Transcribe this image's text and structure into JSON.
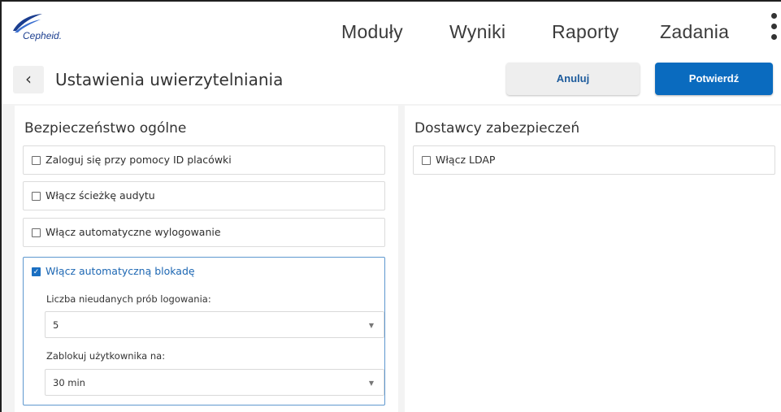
{
  "header": {
    "logo_text": "Cepheid.",
    "nav": [
      "Moduły",
      "Wyniki",
      "Raporty",
      "Zadania"
    ]
  },
  "subheader": {
    "back_icon": "‹",
    "title": "Ustawienia uwierzytelniania",
    "cancel_label": "Anuluj",
    "confirm_label": "Potwierdź"
  },
  "left": {
    "title": "Bezpieczeństwo ogólne",
    "options": [
      {
        "label": "Zaloguj się przy pomocy ID placówki",
        "checked": false
      },
      {
        "label": "Włącz ścieżkę audytu",
        "checked": false
      },
      {
        "label": "Włącz automatyczne wylogowanie",
        "checked": false
      },
      {
        "label": "Włącz automatyczną blokadę",
        "checked": true
      }
    ],
    "lockout": {
      "attempts_label": "Liczba nieudanych prób logowania:",
      "attempts_value": "5",
      "duration_label": "Zablokuj użytkownika na:",
      "duration_value": "30 min"
    }
  },
  "right": {
    "title": "Dostawcy zabezpieczeń",
    "options": [
      {
        "label": "Włącz LDAP",
        "checked": false
      }
    ]
  },
  "colors": {
    "accent": "#0a6bbf",
    "link": "#1d67b3",
    "logo": "#1a3d8f"
  },
  "icons": {
    "check": "✓",
    "caret": "▼"
  }
}
